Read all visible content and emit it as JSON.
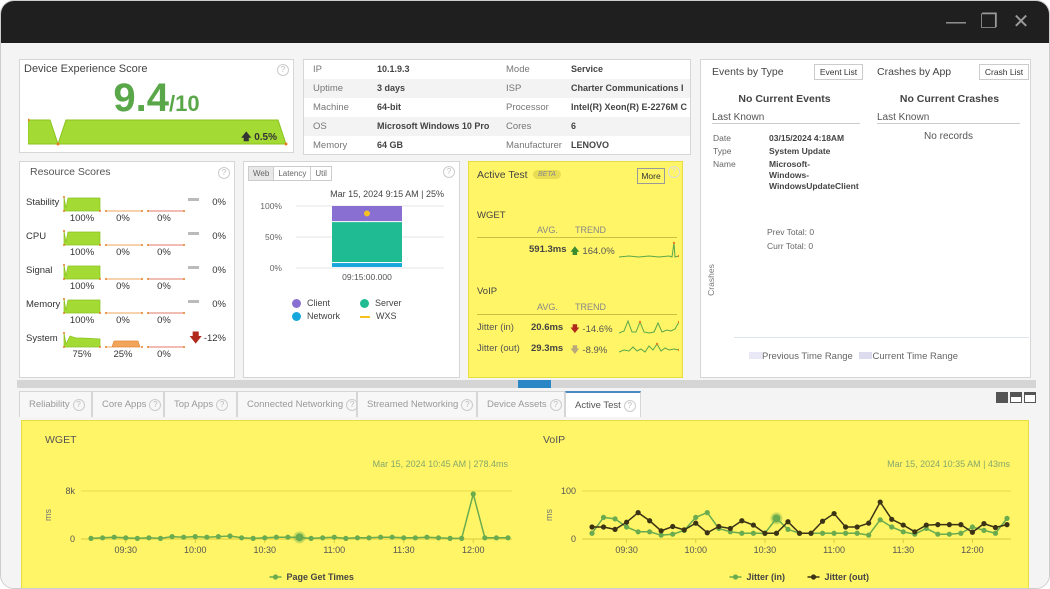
{
  "window": {
    "controls": {
      "minimize": "—",
      "restore": "❐",
      "close": "✕"
    }
  },
  "device_score": {
    "title": "Device Experience Score",
    "score": "9.4",
    "max": "/10",
    "trend": "0.5%",
    "trend_dir": "up",
    "help": "?"
  },
  "device_info": {
    "rows": [
      {
        "k1": "IP",
        "v1": "10.1.9.3",
        "k2": "Mode",
        "v2": "Service"
      },
      {
        "k1": "Uptime",
        "v1": "3 days",
        "k2": "ISP",
        "v2": "Charter Communications I"
      },
      {
        "k1": "Machine",
        "v1": "64-bit",
        "k2": "Processor",
        "v2": "Intel(R) Xeon(R) E-2276M C"
      },
      {
        "k1": "OS",
        "v1": "Microsoft Windows 10 Pro",
        "k2": "Cores",
        "v2": "6"
      },
      {
        "k1": "Memory",
        "v1": "64 GB",
        "k2": "Manufacturer",
        "v2": "LENOVO"
      }
    ]
  },
  "events": {
    "title": "Events by Type",
    "button": "Event List",
    "status": "No Current Events",
    "last_known": "Last Known",
    "details": [
      {
        "k": "Date",
        "v": "03/15/2024 4:18AM"
      },
      {
        "k": "Type",
        "v": "System Update"
      },
      {
        "k": "Name",
        "v": "Microsoft-\nWindows-\nWindowsUpdateClient"
      }
    ],
    "prev_total": "Prev Total: 0",
    "curr_total": "Curr Total: 0"
  },
  "crashes": {
    "title": "Crashes by App",
    "button": "Crash List",
    "status": "No Current Crashes",
    "last_known": "Last Known",
    "no_records": "No records",
    "axis_label": "Crashes",
    "legend": [
      {
        "label": "Previous Time Range",
        "color": "#e8e8f6"
      },
      {
        "label": "Current Time Range",
        "color": "#dcdcee"
      }
    ]
  },
  "resource_scores": {
    "title": "Resource Scores",
    "rows": [
      {
        "label": "Stability",
        "good": "100%",
        "warn": "0%",
        "bad": "0%",
        "trend": "0%",
        "dir": "flat"
      },
      {
        "label": "CPU",
        "good": "100%",
        "warn": "0%",
        "bad": "0%",
        "trend": "0%",
        "dir": "flat"
      },
      {
        "label": "Signal",
        "good": "100%",
        "warn": "0%",
        "bad": "0%",
        "trend": "0%",
        "dir": "flat"
      },
      {
        "label": "Memory",
        "good": "100%",
        "warn": "0%",
        "bad": "0%",
        "trend": "0%",
        "dir": "flat"
      },
      {
        "label": "System",
        "good": "75%",
        "warn": "25%",
        "bad": "0%",
        "trend": "-12%",
        "dir": "down"
      }
    ]
  },
  "web_panel": {
    "tabs": [
      "Web",
      "Latency",
      "Util"
    ],
    "active_tab": "Web",
    "stamp": "Mar 15, 2024 9:15 AM | 25%",
    "legend": [
      {
        "label": "Client",
        "color": "#8a6fd3"
      },
      {
        "label": "Server",
        "color": "#1fbb93"
      },
      {
        "label": "Network",
        "color": "#18a7dc"
      },
      {
        "label": "WXS",
        "color": "#f5c220"
      }
    ]
  },
  "active_test_card": {
    "title": "Active Test",
    "badge": "BETA",
    "more": "More",
    "wget": {
      "title": "WGET",
      "avg_hdr": "AVG.",
      "trend_hdr": "TREND",
      "avg": "591.3ms",
      "trend": "164.0%",
      "dir": "up"
    },
    "voip": {
      "title": "VoIP",
      "avg_hdr": "AVG.",
      "trend_hdr": "TREND",
      "rows": [
        {
          "label": "Jitter (in)",
          "avg": "20.6ms",
          "trend": "-14.6%",
          "dir": "down"
        },
        {
          "label": "Jitter (out)",
          "avg": "29.3ms",
          "trend": "-8.9%",
          "dir": "down-light"
        }
      ]
    }
  },
  "tabs": [
    {
      "label": "Reliability"
    },
    {
      "label": "Core Apps"
    },
    {
      "label": "Top Apps"
    },
    {
      "label": "Connected Networking"
    },
    {
      "label": "Streamed Networking"
    },
    {
      "label": "Device Assets"
    },
    {
      "label": "Active Test",
      "active": true
    }
  ],
  "chart_data": [
    {
      "type": "bar",
      "title": "Web",
      "categories": [
        "09:15:00.000"
      ],
      "series": [
        {
          "name": "Network",
          "values": [
            8
          ]
        },
        {
          "name": "Server",
          "values": [
            66
          ]
        },
        {
          "name": "Client",
          "values": [
            26
          ]
        },
        {
          "name": "WXS",
          "values": [
            88
          ]
        }
      ],
      "yticks": [
        "0%",
        "50%",
        "100%"
      ],
      "ylim": [
        0,
        100
      ],
      "stacked": true,
      "annotation": "Mar 15, 2024 9:15 AM | 25%"
    },
    {
      "type": "line",
      "title": "WGET",
      "ylabel": "ms",
      "ylim": [
        0,
        8000
      ],
      "yticks": [
        "0",
        "8k"
      ],
      "xticks": [
        "09:30",
        "10:00",
        "10:30",
        "11:00",
        "11:30",
        "12:00"
      ],
      "x": [
        "09:15",
        "09:20",
        "09:25",
        "09:30",
        "09:35",
        "09:40",
        "09:45",
        "09:50",
        "09:55",
        "10:00",
        "10:05",
        "10:10",
        "10:15",
        "10:20",
        "10:25",
        "10:30",
        "10:35",
        "10:40",
        "10:45",
        "10:50",
        "10:55",
        "11:00",
        "11:05",
        "11:10",
        "11:15",
        "11:20",
        "11:25",
        "11:30",
        "11:35",
        "11:40",
        "11:45",
        "11:50",
        "11:55",
        "12:00",
        "12:05",
        "12:10",
        "12:15"
      ],
      "series": [
        {
          "name": "Page Get Times",
          "color": "#6aab4f",
          "values": [
            100,
            200,
            300,
            200,
            100,
            200,
            100,
            400,
            300,
            400,
            300,
            400,
            500,
            200,
            100,
            200,
            300,
            300,
            278,
            100,
            200,
            300,
            100,
            200,
            200,
            300,
            300,
            200,
            200,
            300,
            200,
            100,
            100,
            7500,
            200,
            200,
            200
          ]
        }
      ],
      "highlight_index": 18,
      "annotation": "Mar 15, 2024 10:45 AM | 278.4ms",
      "legend": "bottom"
    },
    {
      "type": "line",
      "title": "VoIP",
      "ylabel": "ms",
      "ylim": [
        0,
        100
      ],
      "yticks": [
        "0",
        "100"
      ],
      "xticks": [
        "09:30",
        "10:00",
        "10:30",
        "11:00",
        "11:30",
        "12:00"
      ],
      "x": [
        "09:15",
        "09:20",
        "09:25",
        "09:30",
        "09:35",
        "09:40",
        "09:45",
        "09:50",
        "09:55",
        "10:00",
        "10:05",
        "10:10",
        "10:15",
        "10:20",
        "10:25",
        "10:30",
        "10:35",
        "10:40",
        "10:45",
        "10:50",
        "10:55",
        "11:00",
        "11:05",
        "11:10",
        "11:15",
        "11:20",
        "11:25",
        "11:30",
        "11:35",
        "11:40",
        "11:45",
        "11:50",
        "11:55",
        "12:00",
        "12:05",
        "12:10",
        "12:15"
      ],
      "series": [
        {
          "name": "Jitter (in)",
          "color": "#6aab4f",
          "values": [
            12,
            45,
            42,
            25,
            15,
            15,
            8,
            10,
            18,
            45,
            55,
            22,
            15,
            12,
            12,
            12,
            43,
            20,
            12,
            12,
            12,
            12,
            12,
            12,
            8,
            40,
            25,
            15,
            10,
            22,
            10,
            10,
            12,
            25,
            18,
            12,
            43
          ]
        },
        {
          "name": "Jitter (out)",
          "color": "#3b3316",
          "values": [
            25,
            25,
            20,
            35,
            55,
            38,
            17,
            26,
            19,
            33,
            13,
            26,
            22,
            38,
            29,
            12,
            12,
            36,
            12,
            12,
            37,
            53,
            25,
            25,
            33,
            77,
            41,
            29,
            15,
            29,
            30,
            30,
            30,
            14,
            32,
            24,
            30
          ]
        }
      ],
      "highlight_index": 16,
      "annotation": "Mar 15, 2024 10:35 AM | 43ms",
      "legend": "bottom"
    }
  ]
}
